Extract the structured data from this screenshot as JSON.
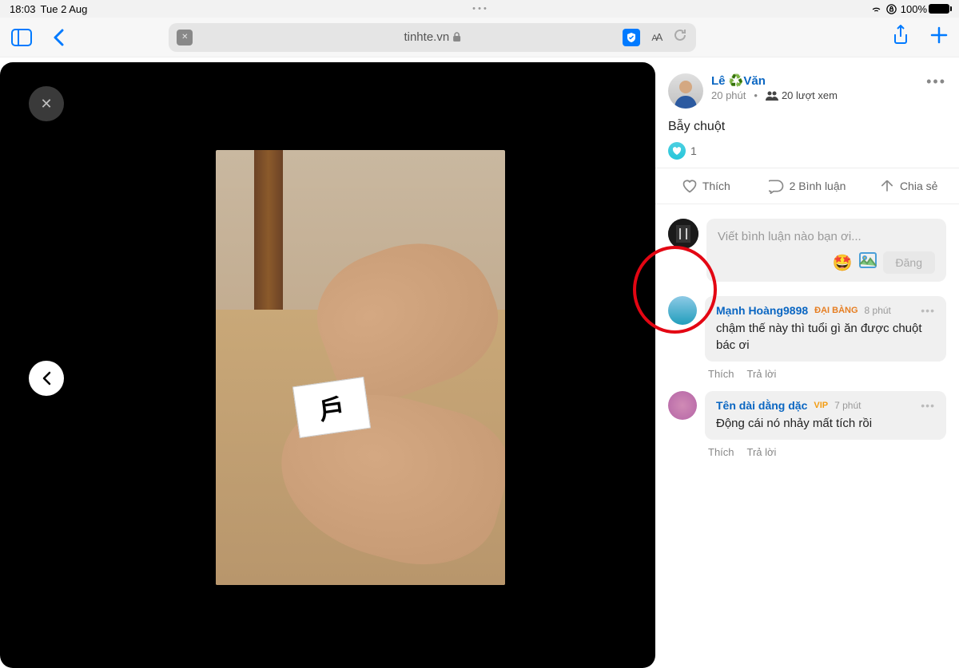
{
  "status": {
    "time": "18:03",
    "date": "Tue 2 Aug",
    "battery": "100%"
  },
  "browser": {
    "url_text": "tinhte.vn",
    "aa_small": "A",
    "aa_large": "A"
  },
  "post": {
    "author": "Lê ♻️Văn",
    "time": "20 phút",
    "views": "20 lượt xem",
    "title": "Bẫy chuột",
    "react_count": "1"
  },
  "actions": {
    "like": "Thích",
    "comment": "2 Bình luận",
    "share": "Chia sẻ"
  },
  "comment_box": {
    "placeholder": "Viết bình luận nào bạn ơi...",
    "submit": "Đăng"
  },
  "comments": [
    {
      "name": "Mạnh Hoàng9898",
      "badge": "ĐẠI BÀNG",
      "time": "8 phút",
      "text": "chậm thế này thì tuổi gì ăn được chuột bác ơi",
      "like": "Thích",
      "reply": "Trả lời"
    },
    {
      "name": "Tên dài dằng dặc",
      "badge": "VIP",
      "time": "7 phút",
      "text": "Động cái nó nhảy mất tích rồi",
      "like": "Thích",
      "reply": "Trả lời"
    }
  ]
}
